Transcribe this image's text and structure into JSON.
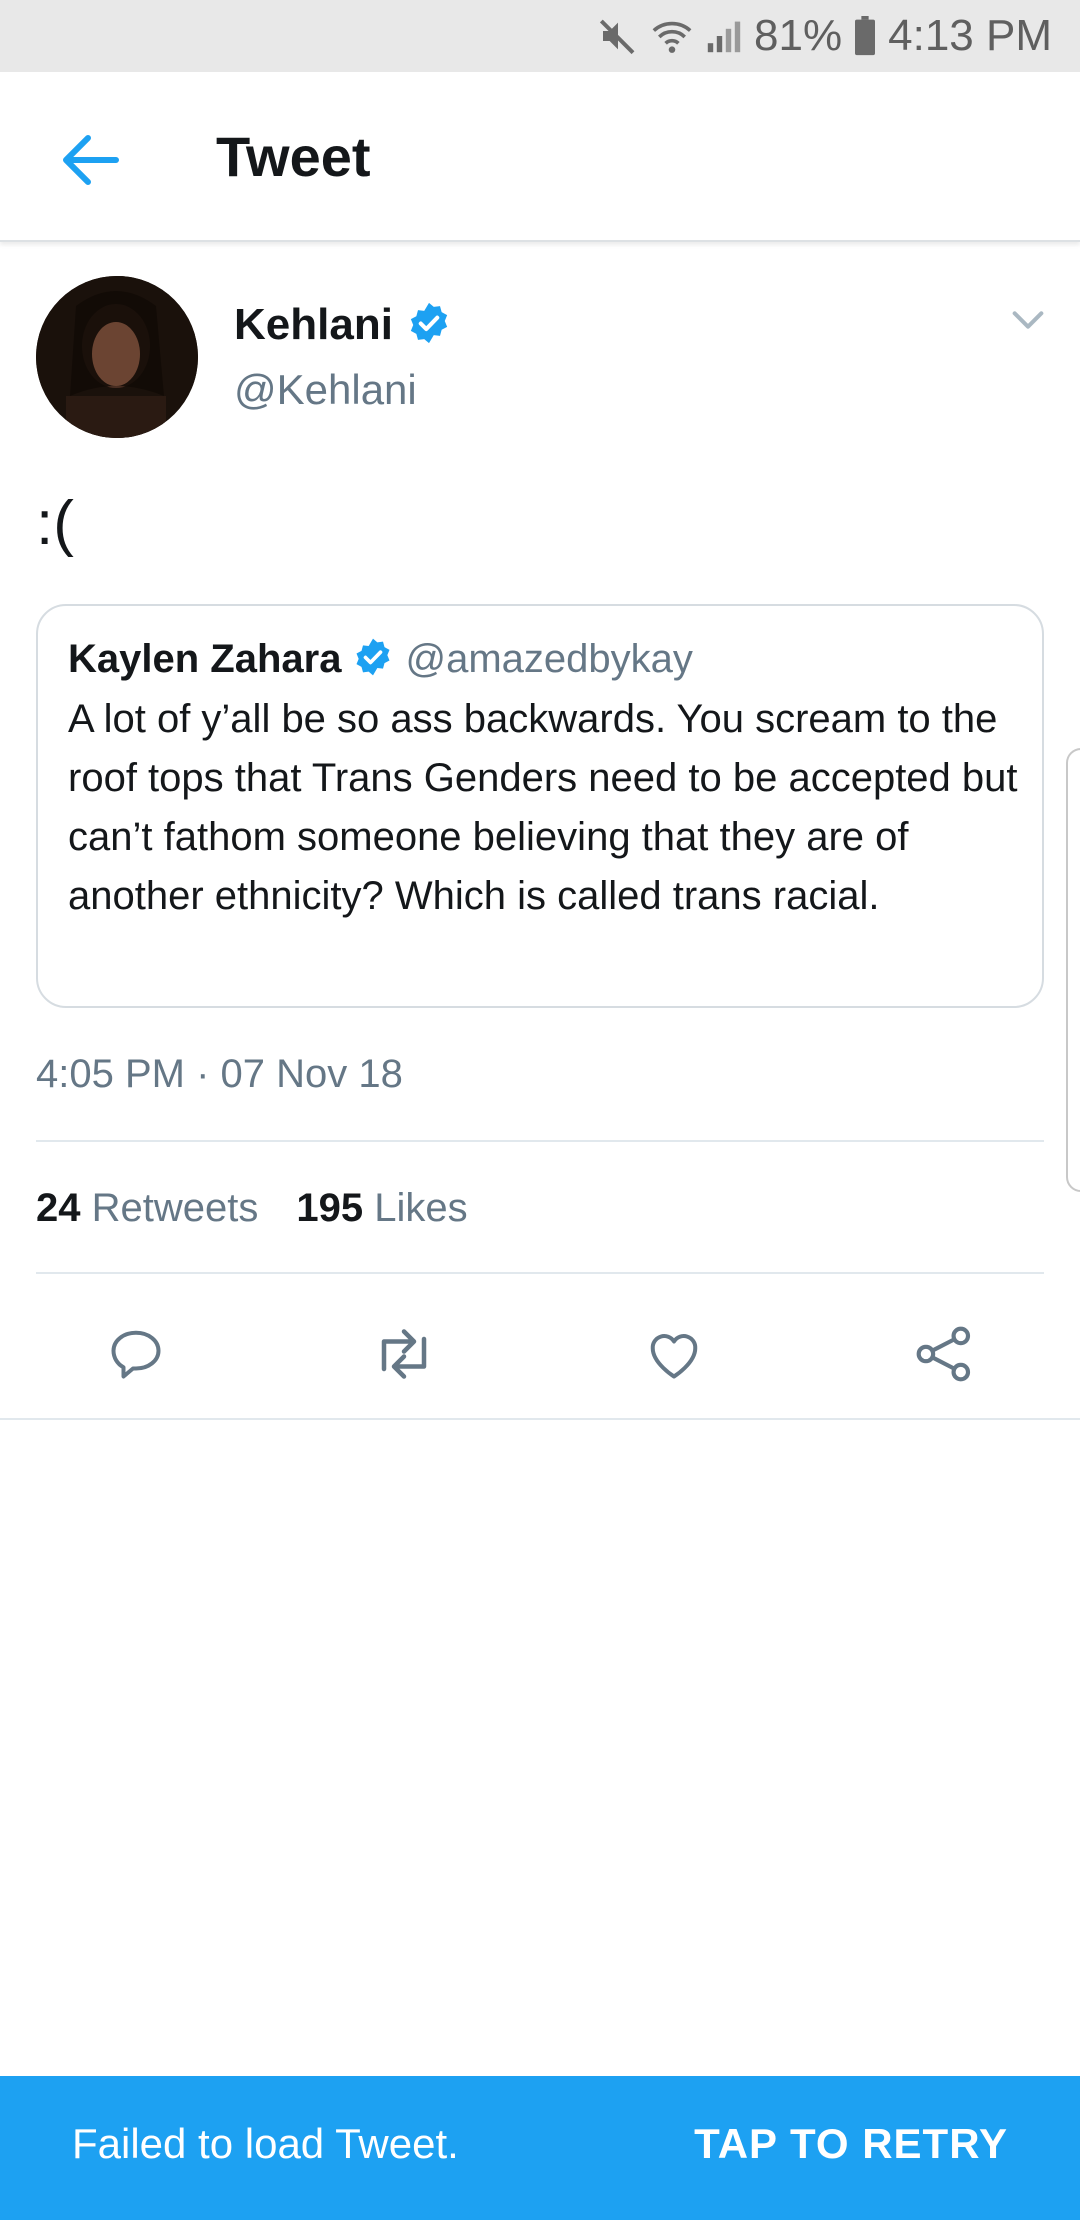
{
  "status_bar": {
    "battery": "81%",
    "time": "4:13 PM",
    "icons": [
      "mute-icon",
      "wifi-icon",
      "signal-icon",
      "battery-icon"
    ]
  },
  "header": {
    "title": "Tweet",
    "back_icon": "back-arrow-icon"
  },
  "tweet": {
    "author_name": "Kehlani",
    "author_handle": "@Kehlani",
    "verified": true,
    "text": ":(",
    "timestamp": "4:05 PM · 07 Nov 18",
    "retweets": "24",
    "retweets_label": "Retweets",
    "likes": "195",
    "likes_label": "Likes"
  },
  "quoted_tweet": {
    "author_name": "Kaylen Zahara",
    "author_handle": "@amazedbykay",
    "verified": true,
    "text": "A lot of y’all be so ass backwards. You scream to the roof tops that Trans Genders need to be accepted but can’t fathom someone believing that they are of another ethnicity? Which is called trans racial."
  },
  "actions": [
    "reply-icon",
    "retweet-icon",
    "like-icon",
    "share-icon"
  ],
  "snackbar": {
    "message": "Failed to load Tweet.",
    "action": "TAP TO RETRY"
  },
  "colors": {
    "accent": "#1da1f2",
    "muted": "#657786",
    "text": "#14171a",
    "status_bar_bg": "#e8e8e8"
  }
}
